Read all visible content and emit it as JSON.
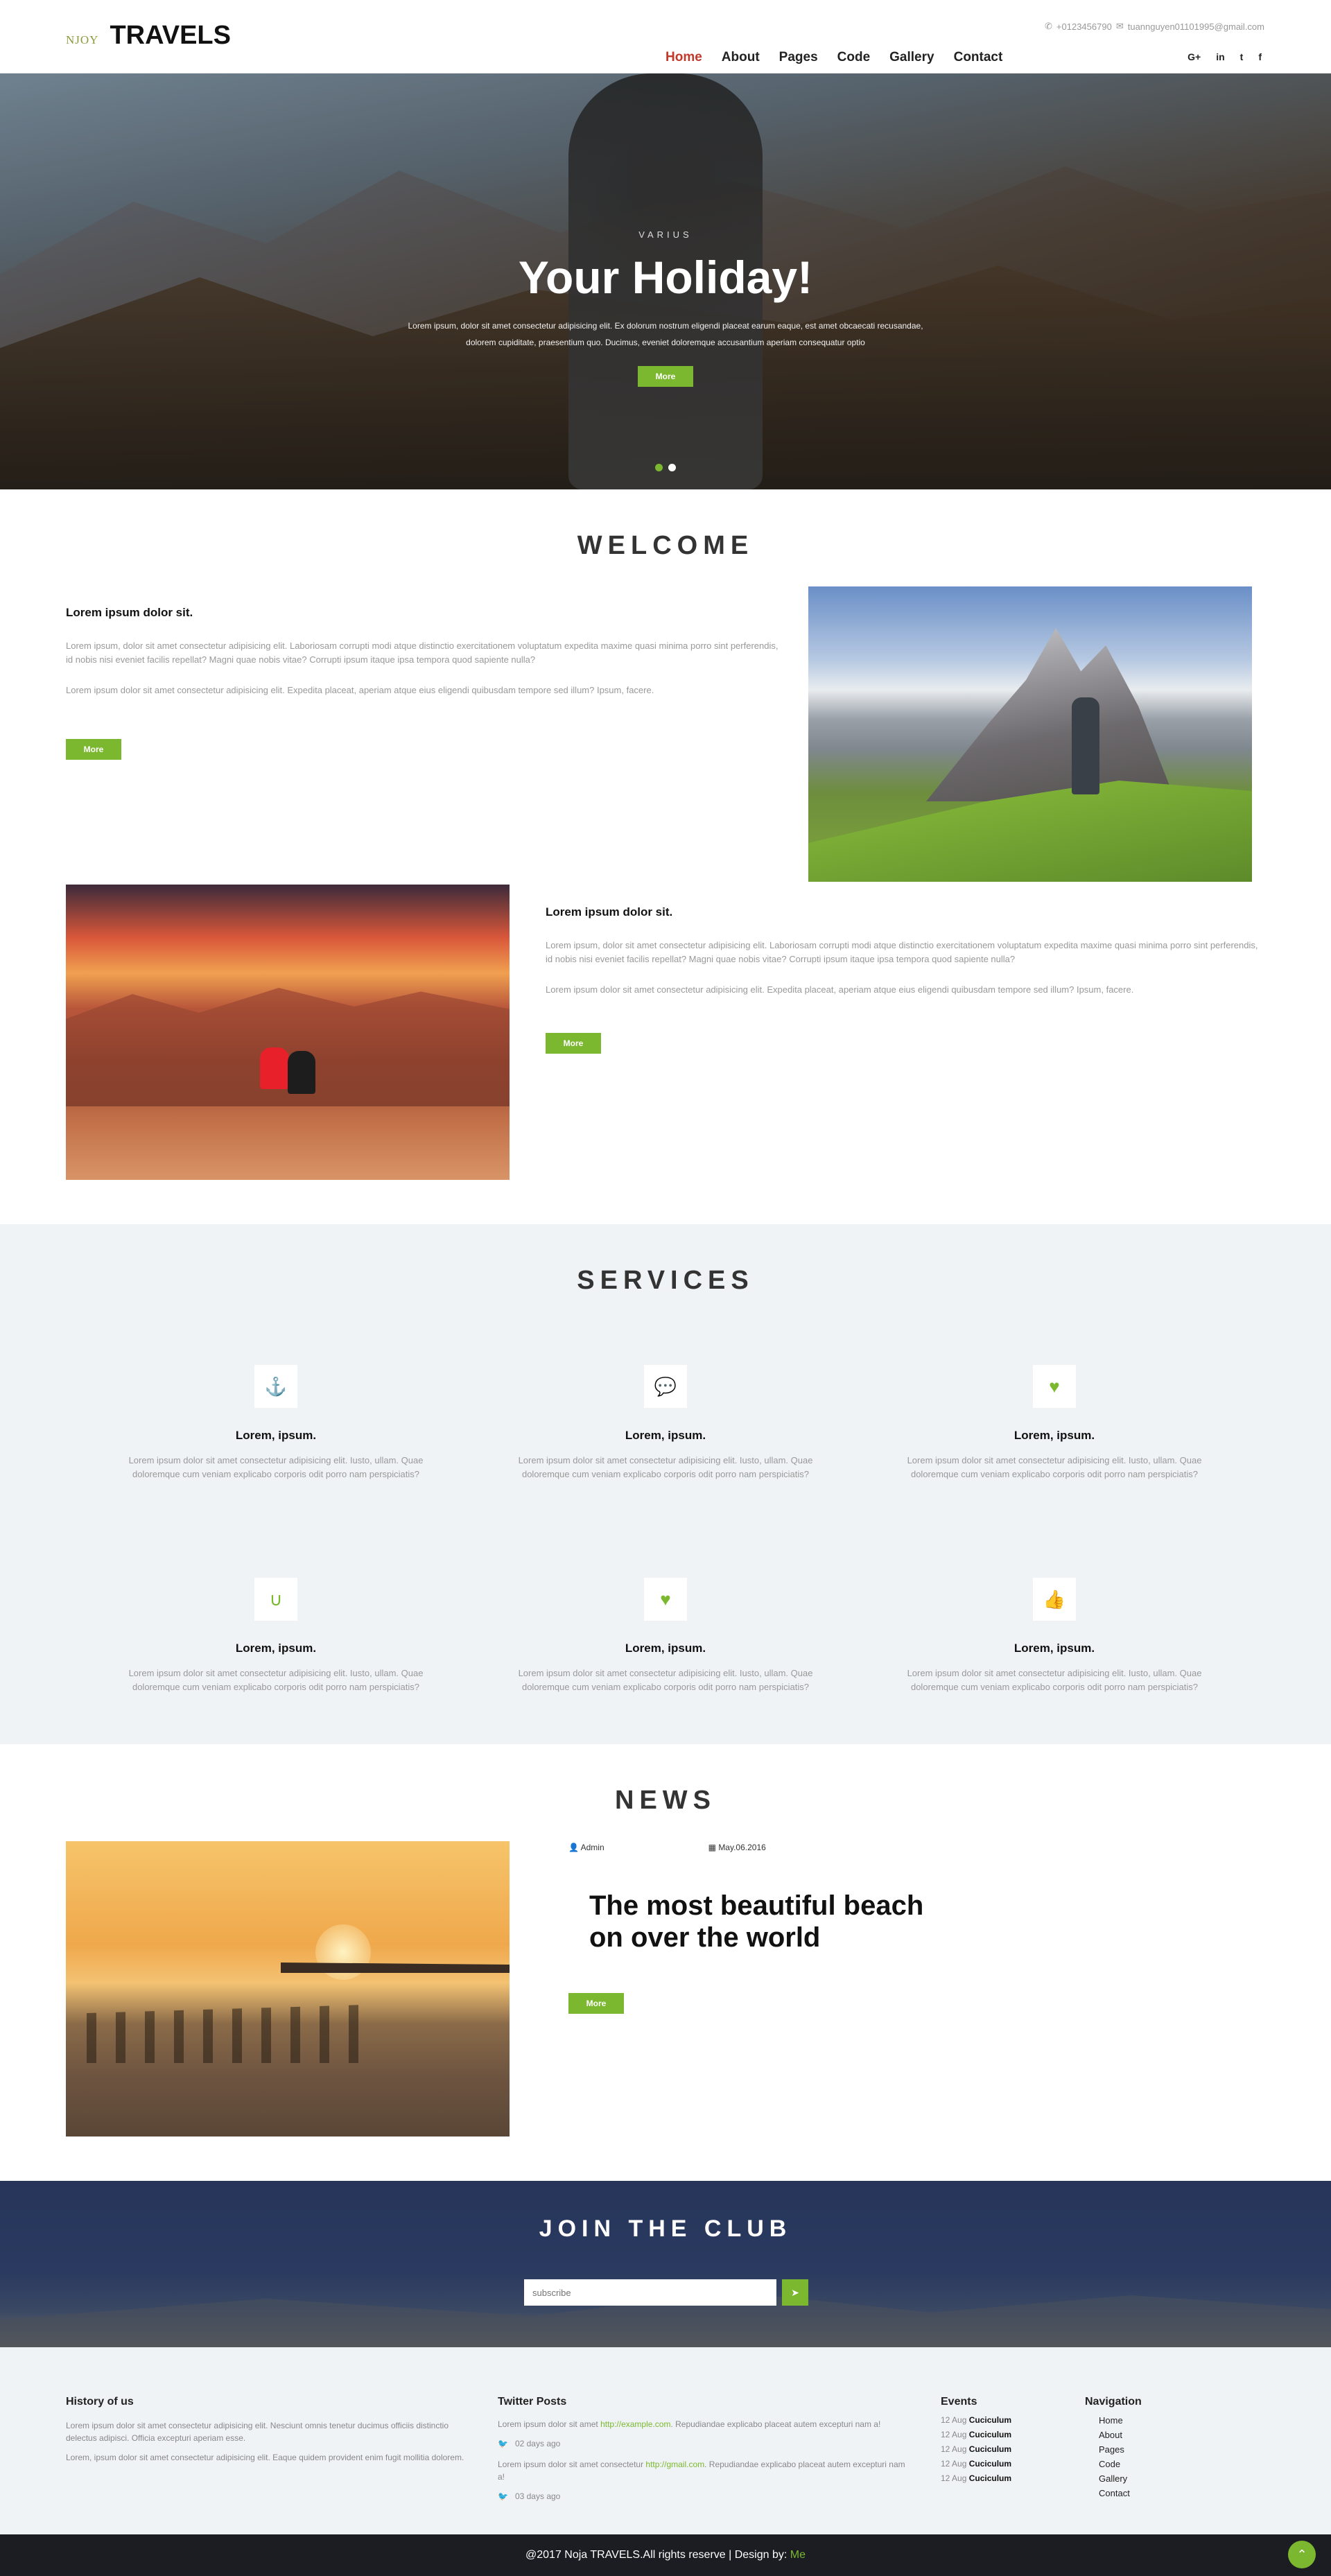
{
  "header": {
    "logo_small": "NJOY",
    "logo_big": "TRAVELS",
    "phone": "+0123456790",
    "email": "tuannguyen01101995@gmail.com",
    "nav": [
      "Home",
      "About",
      "Pages",
      "Code",
      "Gallery",
      "Contact"
    ],
    "social": [
      "G+",
      "in",
      "t",
      "f"
    ]
  },
  "hero": {
    "eyebrow": "VARIUS",
    "title": "Your Holiday!",
    "text": "Lorem ipsum, dolor sit amet consectetur adipisicing elit. Ex dolorum nostrum eligendi placeat earum eaque, est amet obcaecati recusandae, dolorem cupiditate, praesentium quo. Ducimus, eveniet doloremque accusantium aperiam consequatur optio",
    "button": "More"
  },
  "welcome": {
    "title": "WELCOME",
    "blocks": [
      {
        "heading": "Lorem ipsum dolor sit.",
        "para1": "Lorem ipsum, dolor sit amet consectetur adipisicing elit. Laboriosam corrupti modi atque distinctio exercitationem voluptatum expedita maxime quasi minima porro sint perferendis, id nobis nisi eveniet facilis repellat? Magni quae nobis vitae? Corrupti ipsum itaque ipsa tempora quod sapiente nulla?",
        "para2": "Lorem ipsum dolor sit amet consectetur adipisicing elit. Expedita placeat, aperiam atque eius eligendi quibusdam tempore sed illum? Ipsum, facere.",
        "button": "More"
      },
      {
        "heading": "Lorem ipsum dolor sit.",
        "para1": "Lorem ipsum, dolor sit amet consectetur adipisicing elit. Laboriosam corrupti modi atque distinctio exercitationem voluptatum expedita maxime quasi minima porro sint perferendis, id nobis nisi eveniet facilis repellat? Magni quae nobis vitae? Corrupti ipsum itaque ipsa tempora quod sapiente nulla?",
        "para2": "Lorem ipsum dolor sit amet consectetur adipisicing elit. Expedita placeat, aperiam atque eius eligendi quibusdam tempore sed illum? Ipsum, facere.",
        "button": "More"
      }
    ]
  },
  "services": {
    "title": "SERVICES",
    "items": [
      {
        "icon": "anchor-icon",
        "glyph": "⚓",
        "title": "Lorem, ipsum.",
        "text": "Lorem ipsum dolor sit amet consectetur adipisicing elit. Iusto, ullam. Quae doloremque cum veniam explicabo corporis odit porro nam perspiciatis?"
      },
      {
        "icon": "comment-icon",
        "glyph": "💬",
        "title": "Lorem, ipsum.",
        "text": "Lorem ipsum dolor sit amet consectetur adipisicing elit. Iusto, ullam. Quae doloremque cum veniam explicabo corporis odit porro nam perspiciatis?"
      },
      {
        "icon": "heartbeat-icon",
        "glyph": "♥",
        "title": "Lorem, ipsum.",
        "text": "Lorem ipsum dolor sit amet consectetur adipisicing elit. Iusto, ullam. Quae doloremque cum veniam explicabo corporis odit porro nam perspiciatis?"
      },
      {
        "icon": "magnet-icon",
        "glyph": "∪",
        "title": "Lorem, ipsum.",
        "text": "Lorem ipsum dolor sit amet consectetur adipisicing elit. Iusto, ullam. Quae doloremque cum veniam explicabo corporis odit porro nam perspiciatis?"
      },
      {
        "icon": "heartbeat-icon",
        "glyph": "♥",
        "title": "Lorem, ipsum.",
        "text": "Lorem ipsum dolor sit amet consectetur adipisicing elit. Iusto, ullam. Quae doloremque cum veniam explicabo corporis odit porro nam perspiciatis?"
      },
      {
        "icon": "thumbs-up-icon",
        "glyph": "👍",
        "title": "Lorem, ipsum.",
        "text": "Lorem ipsum dolor sit amet consectetur adipisicing elit. Iusto, ullam. Quae doloremque cum veniam explicabo corporis odit porro nam perspiciatis?"
      }
    ]
  },
  "news": {
    "title": "NEWS",
    "author": "Admin",
    "date": "May.06.2016",
    "headline": "The most beautiful beach on over the world",
    "button": "More"
  },
  "join": {
    "title": "JOIN THE CLUB",
    "placeholder": "subscribe"
  },
  "footer": {
    "history": {
      "title": "History of us",
      "p1": "Lorem ipsum dolor sit amet consectetur adipisicing elit. Nesciunt omnis tenetur ducimus officiis distinctio delectus adipisci. Officia excepturi aperiam esse.",
      "p2": "Lorem, ipsum dolor sit amet consectetur adipisicing elit. Eaque quidem provident enim fugit mollitia dolorem."
    },
    "twitter": {
      "title": "Twitter Posts",
      "posts": [
        {
          "before": "Lorem ipsum dolor sit amet ",
          "link": "http://example.com",
          "after": ". Repudiandae explicabo placeat autem excepturi nam a!",
          "date": "02 days ago"
        },
        {
          "before": "Lorem ipsum dolor sit amet consectetur ",
          "link": "http://gmail.com",
          "after": ". Repudiandae explicabo placeat autem excepturi nam a!",
          "date": "03 days ago"
        }
      ]
    },
    "events": {
      "title": "Events",
      "items": [
        {
          "date": "12 Aug",
          "name": "Cuciculum"
        },
        {
          "date": "12 Aug",
          "name": "Cuciculum"
        },
        {
          "date": "12 Aug",
          "name": "Cuciculum"
        },
        {
          "date": "12 Aug",
          "name": "Cuciculum"
        },
        {
          "date": "12 Aug",
          "name": "Cuciculum"
        }
      ]
    },
    "navigation": {
      "title": "Navigation",
      "items": [
        "Home",
        "About",
        "Pages",
        "Code",
        "Gallery",
        "Contact"
      ]
    }
  },
  "copyright": {
    "text": "@2017 Noja TRAVELS.All rights reserve | Design by: ",
    "designer": "Me"
  },
  "colors": {
    "accent": "#7cb82f",
    "nav_active": "#c0392b"
  }
}
